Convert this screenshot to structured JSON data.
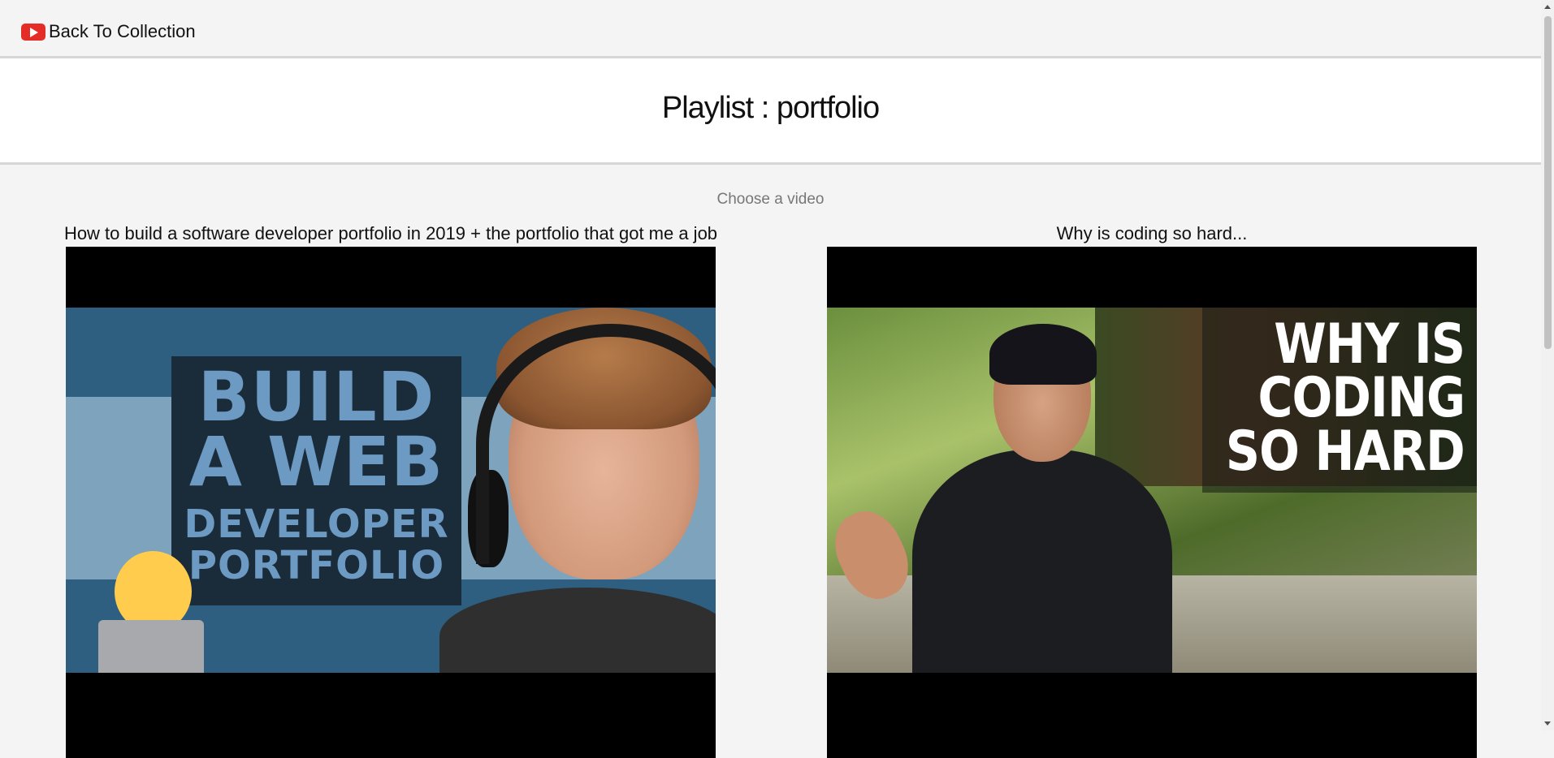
{
  "header": {
    "back_label": "Back To Collection",
    "icon": "youtube-icon"
  },
  "page": {
    "title": "Playlist : portfolio",
    "subtitle": "Choose a video"
  },
  "videos": [
    {
      "title": "How to build a software developer portfolio in 2019 + the portfolio that got me a job",
      "thumbnail_text": [
        "BUILD",
        "A WEB",
        "DEVELOPER",
        "PORTFOLIO"
      ]
    },
    {
      "title": "Why is coding so hard...",
      "thumbnail_text": [
        "WHY IS",
        "CODING",
        "SO HARD"
      ]
    }
  ],
  "colors": {
    "background": "#f4f4f4",
    "accent_red": "#e52d27",
    "thumb1_blue": "#2e5f81",
    "thumb1_text": "#6c9ac2"
  }
}
